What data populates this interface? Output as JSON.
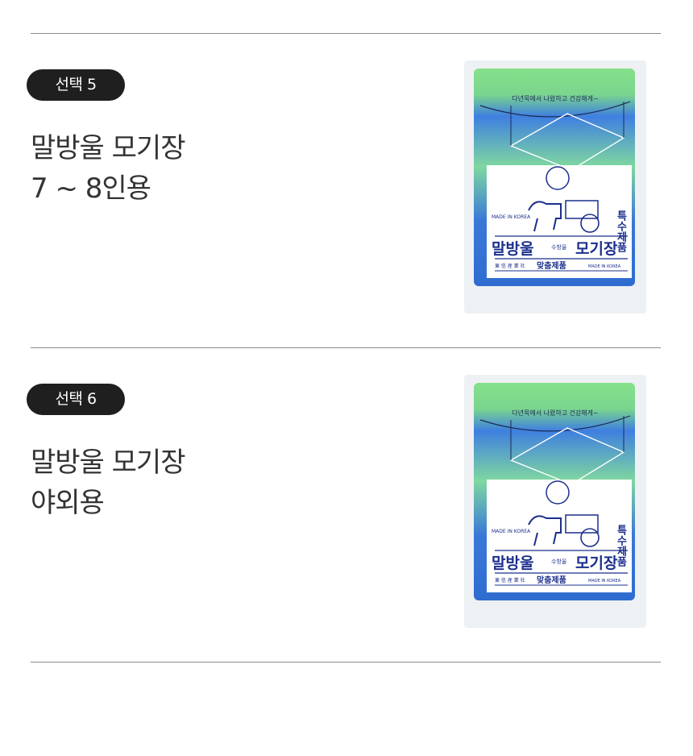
{
  "options": [
    {
      "badge": "선택 5",
      "name": "말방울 모기장",
      "size": "7 ~ 8인용"
    },
    {
      "badge": "선택 6",
      "name": "말방울 모기장",
      "size": "야외용"
    }
  ],
  "package": {
    "top_text": "다년목에서 나왔하고 건강해게~",
    "made_in": "MADE IN KOREA",
    "special": "특수제품",
    "brand": "말방울",
    "product": "모기장",
    "seal": "수방울",
    "custom": "맞춤제품",
    "maker": "東 信 産 業 社",
    "made_in_small": "MADE IN KOREA"
  },
  "colors": {
    "badge_bg": "#1f1f1f",
    "divider": "#8a8a8a",
    "net_blue": "#3a78d8",
    "net_green": "#86e08a",
    "label_navy": "#1b2f8c"
  }
}
